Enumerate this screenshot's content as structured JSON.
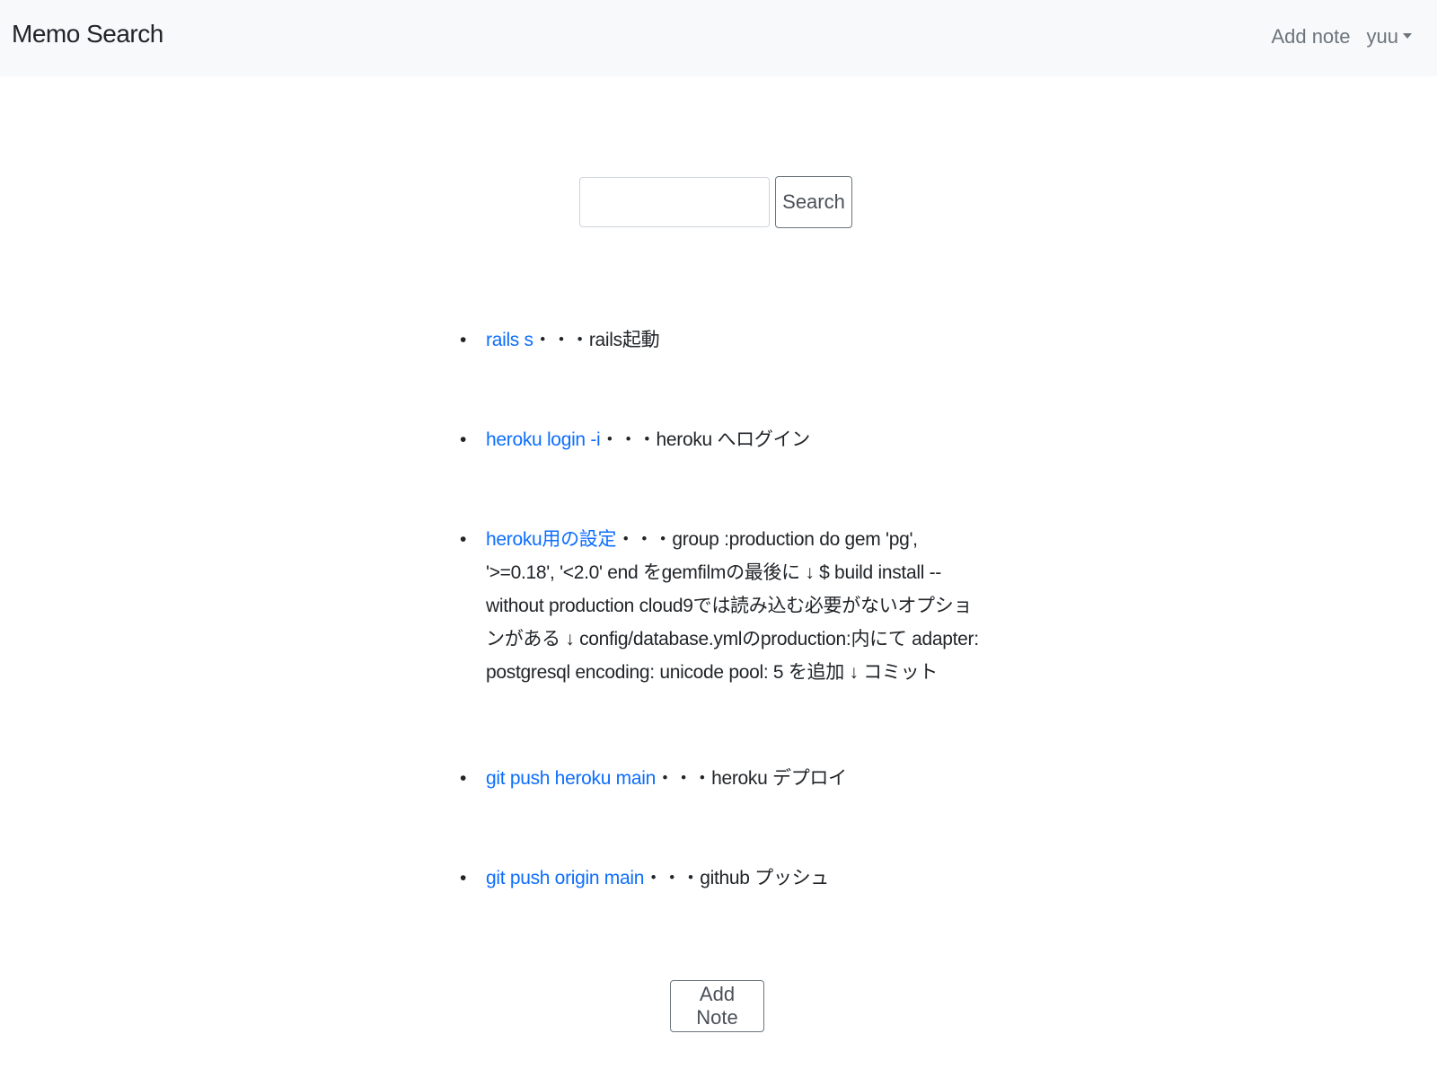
{
  "navbar": {
    "brand": "Memo Search",
    "add_note_link": "Add note",
    "user_menu": "yuu",
    "user_menu_icon": "caret-down-icon"
  },
  "search": {
    "input_value": "",
    "button_label": "Search"
  },
  "memos": [
    {
      "title": "rails s",
      "separator": "・・・",
      "body": "rails起動"
    },
    {
      "title": "heroku login -i",
      "separator": "・・・",
      "body": "heroku へログイン"
    },
    {
      "title": "heroku用の設定",
      "separator": "・・・",
      "body": "group :production do gem 'pg', '>=0.18', '<2.0' end をgemfilmの最後に ↓ $ build install --without production cloud9では読み込む必要がないオプションがある ↓ config/database.ymlのproduction:内にて adapter: postgresql encoding: unicode pool: 5 を追加 ↓ コミット"
    },
    {
      "title": "git push heroku main",
      "separator": "・・・",
      "body": "heroku デプロイ"
    },
    {
      "title": "git push origin main",
      "separator": "・・・",
      "body": "github プッシュ"
    }
  ],
  "footer": {
    "add_note_button": "Add Note"
  },
  "colors": {
    "navbar_bg": "#f8f9fa",
    "link": "#0d6efd",
    "nav_text": "#6c757d"
  }
}
